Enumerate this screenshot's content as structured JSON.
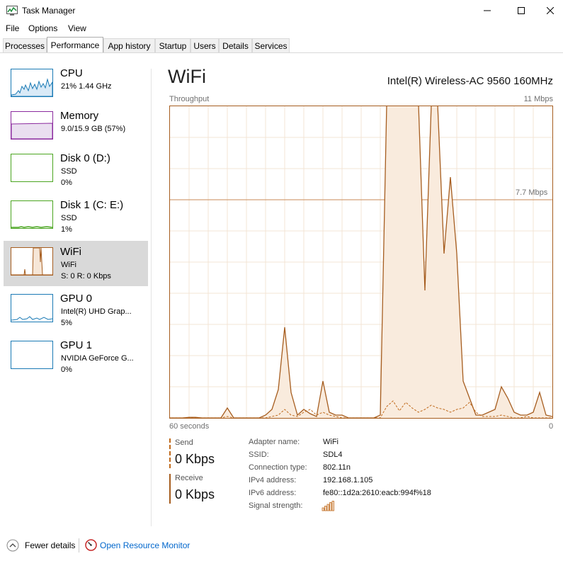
{
  "window": {
    "title": "Task Manager"
  },
  "menu": [
    "File",
    "Options",
    "View"
  ],
  "tabs": [
    "Processes",
    "Performance",
    "App history",
    "Startup",
    "Users",
    "Details",
    "Services"
  ],
  "sidebar": [
    {
      "name": "CPU",
      "line1": "21% 1.44 GHz",
      "line2": "",
      "color": "#1a7ab5"
    },
    {
      "name": "Memory",
      "line1": "9.0/15.9 GB (57%)",
      "line2": "",
      "color": "#8b2a9e"
    },
    {
      "name": "Disk 0 (D:)",
      "line1": "SSD",
      "line2": "0%",
      "color": "#4aa520"
    },
    {
      "name": "Disk 1 (C: E:)",
      "line1": "SSD",
      "line2": "1%",
      "color": "#4aa520"
    },
    {
      "name": "WiFi",
      "line1": "WiFi",
      "line2": "S: 0 R: 0 Kbps",
      "color": "#a65d1f"
    },
    {
      "name": "GPU 0",
      "line1": "Intel(R) UHD Grap...",
      "line2": "5%",
      "color": "#1a7ab5"
    },
    {
      "name": "GPU 1",
      "line1": "NVIDIA GeForce G...",
      "line2": "0%",
      "color": "#1a7ab5"
    }
  ],
  "main": {
    "title": "WiFi",
    "adapter": "Intel(R) Wireless-AC 9560 160MHz",
    "throughput_label": "Throughput",
    "max_label": "11 Mbps",
    "mid_label": "7.7 Mbps",
    "x_left_label": "60 seconds",
    "x_right_label": "0"
  },
  "stats": {
    "send_label": "Send",
    "send_value": "0 Kbps",
    "receive_label": "Receive",
    "receive_value": "0 Kbps"
  },
  "properties": [
    {
      "label": "Adapter name:",
      "value": "WiFi"
    },
    {
      "label": "SSID:",
      "value": "SDL4"
    },
    {
      "label": "Connection type:",
      "value": "802.11n"
    },
    {
      "label": "IPv4 address:",
      "value": "192.168.1.105"
    },
    {
      "label": "IPv6 address:",
      "value": "fe80::1d2a:2610:eacb:994f%18"
    },
    {
      "label": "Signal strength:",
      "value": ""
    }
  ],
  "footer": {
    "fewer_details": "Fewer details",
    "open_monitor": "Open Resource Monitor"
  },
  "chart_data": {
    "type": "area",
    "ymax_mbps": 11,
    "gridline_mbps": 7.7,
    "x_seconds": [
      60,
      59,
      58,
      57,
      56,
      55,
      54,
      53,
      52,
      51,
      50,
      49,
      48,
      47,
      46,
      45,
      44,
      43,
      42,
      41,
      40,
      39,
      38,
      37,
      36,
      35,
      34,
      33,
      32,
      31,
      30,
      29,
      28,
      27,
      26,
      25,
      24,
      23,
      22,
      21,
      20,
      19,
      18,
      17,
      16,
      15,
      14,
      13,
      12,
      11,
      10,
      9,
      8,
      7,
      6,
      5,
      4,
      3,
      2,
      1,
      0
    ],
    "series": [
      {
        "name": "Receive",
        "values": [
          0,
          0,
          0,
          0.02,
          0.02,
          0,
          0,
          0,
          0,
          0.35,
          0,
          0,
          0,
          0,
          0,
          0.1,
          0.3,
          1,
          3.2,
          0.9,
          0.1,
          0.3,
          0.15,
          0.05,
          1.3,
          0.2,
          0.1,
          0.1,
          0,
          0,
          0,
          0,
          0,
          0.1,
          12,
          12,
          12,
          12,
          12,
          12,
          4.5,
          12,
          12,
          5.8,
          8.5,
          5.8,
          1.3,
          0.7,
          0.1,
          0.1,
          0.2,
          0.3,
          1.1,
          0.7,
          0.2,
          0.1,
          0.1,
          0.2,
          0.9,
          0.1,
          0.05
        ]
      },
      {
        "name": "Send",
        "values": [
          0,
          0,
          0,
          0,
          0,
          0,
          0,
          0,
          0,
          0.05,
          0,
          0,
          0,
          0,
          0,
          0,
          0.05,
          0.1,
          0.3,
          0.1,
          0.05,
          0.2,
          0.3,
          0.1,
          0.2,
          0.1,
          0.05,
          0,
          0,
          0,
          0,
          0,
          0,
          0,
          0.4,
          0.6,
          0.25,
          0.55,
          0.35,
          0.2,
          0.3,
          0.45,
          0.35,
          0.3,
          0.2,
          0.3,
          0.35,
          0.55,
          0.2,
          0.05,
          0.05,
          0.05,
          0.1,
          0.05,
          0,
          0,
          0.05,
          0,
          0,
          0,
          0
        ]
      }
    ]
  }
}
